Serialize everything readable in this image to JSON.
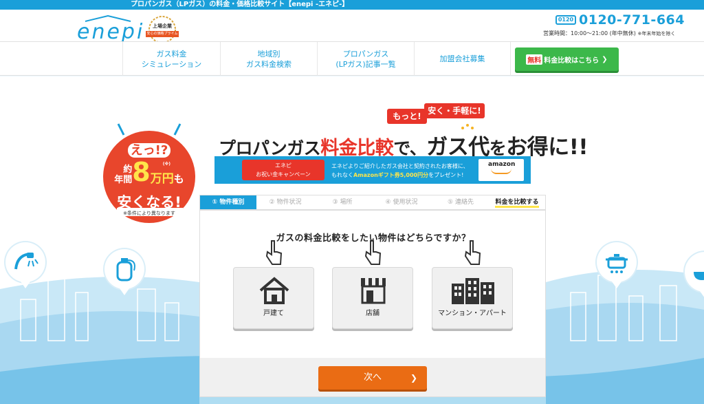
{
  "topbar": {
    "text": "プロパンガス（LPガス）の料金・価格比較サイト【enepi -エネピ-】"
  },
  "header": {
    "logo_text": "enepi",
    "badge_line1": "上場企業",
    "badge_line2": "安心の価格プライム",
    "phone_icon": "0120",
    "phone_number": "0120-771-664",
    "hours": "営業時間：10:00～21:00 (年中無休)",
    "hours_note": "※年末年始を除く"
  },
  "nav": {
    "items": [
      {
        "label": "ガス料金\nシミュレーション"
      },
      {
        "label": "地域別\nガス料金検索"
      },
      {
        "label": "プロパンガス\n(LPガス)記事一覧"
      },
      {
        "label": "加盟会社募集"
      }
    ],
    "cta_free": "無料",
    "cta_label": "料金比較はこちら",
    "cta_icon": "chevron-right-icon"
  },
  "hero": {
    "burst_top": "えっ!?",
    "burst_prefix1": "約",
    "burst_prefix2": "年間",
    "burst_number": "8",
    "burst_unit": "万円",
    "burst_note_mark": "(※)",
    "burst_suffix": "も",
    "burst_bottom": "安くなる!",
    "burst_note": "※条件により異なります",
    "tag1": "もっと!",
    "tag2": "安く・手軽に!",
    "headline_a": "プロパンガス",
    "headline_b": "料金比較",
    "headline_c": "で、",
    "headline_d": "ガス代",
    "headline_e": "を",
    "headline_f": "お得に!!",
    "campaign_ribbon": "エネピ\nお祝い金キャンペーン",
    "campaign_text_1": "エネピよりご紹介したガス会社と契約されたお客様に、",
    "campaign_text_2a": "もれなく",
    "campaign_text_2b": "Amazonギフト券5,000円分",
    "campaign_text_2c": "をプレゼント!",
    "campaign_card": "amazon"
  },
  "steps": [
    {
      "label": "① 物件種別"
    },
    {
      "label": "② 物件状況"
    },
    {
      "label": "③ 場所"
    },
    {
      "label": "④ 使用状況"
    },
    {
      "label": "⑤ 連絡先"
    },
    {
      "label": "料金を比較する"
    }
  ],
  "form": {
    "question": "ガスの料金比較をしたい物件はどちらですか？",
    "choices": [
      {
        "label": "戸建て",
        "icon": "house-icon"
      },
      {
        "label": "店舗",
        "icon": "store-icon"
      },
      {
        "label": "マンション・アパート",
        "icon": "apartment-icon"
      }
    ],
    "next_label": "次へ",
    "next_icon": "chevron-right-icon"
  },
  "colors": {
    "primary": "#1a9fd9",
    "accent_red": "#e8352a",
    "cta_green": "#3cb84a",
    "next_orange": "#ea6c14",
    "highlight_yellow": "#ffe54a"
  }
}
